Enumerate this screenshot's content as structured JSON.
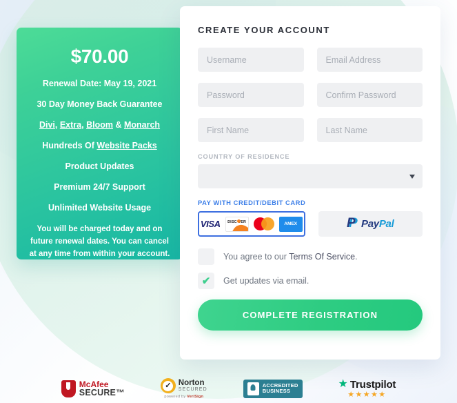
{
  "price_panel": {
    "amount": "$70.00",
    "renewal": "Renewal Date: May 19, 2021",
    "guarantee": "30 Day Money Back Guarantee",
    "products": {
      "divi": "Divi",
      "sep1": ", ",
      "extra": "Extra",
      "sep2": ", ",
      "bloom": "Bloom",
      "sep3": " & ",
      "monarch": "Monarch"
    },
    "packs_prefix": "Hundreds Of ",
    "packs_link": "Website Packs",
    "updates": "Product Updates",
    "support": "Premium 24/7 Support",
    "usage": "Unlimited Website Usage",
    "note": "You will be charged today and on future renewal dates. You can cancel at any time from within your account."
  },
  "form": {
    "title": "CREATE YOUR ACCOUNT",
    "fields": {
      "username": {
        "placeholder": "Username",
        "value": ""
      },
      "email": {
        "placeholder": "Email Address",
        "value": ""
      },
      "password": {
        "placeholder": "Password",
        "value": ""
      },
      "confirm_password": {
        "placeholder": "Confirm Password",
        "value": ""
      },
      "first_name": {
        "placeholder": "First Name",
        "value": ""
      },
      "last_name": {
        "placeholder": "Last Name",
        "value": ""
      }
    },
    "country": {
      "label": "COUNTRY OF RESIDENCE",
      "selected": "",
      "caret_icon": "chevron-down-icon"
    },
    "payment": {
      "label": "PAY WITH CREDIT/DEBIT CARD",
      "card_option": {
        "selected": true,
        "logos": [
          "VISA",
          "DISCOVER",
          "mastercard",
          "AMEX"
        ]
      },
      "paypal_option": {
        "selected": false,
        "label_pay": "Pay",
        "label_pal": "Pal"
      }
    },
    "terms": {
      "checked": false,
      "text_prefix": "You agree to our ",
      "link": "Terms Of Service",
      "text_suffix": "."
    },
    "updates_opt_in": {
      "checked": true,
      "check_icon": "checkmark-icon",
      "text": "Get updates via email."
    },
    "submit_label": "COMPLETE REGISTRATION"
  },
  "badges": {
    "mcafee": {
      "line1": "McAfee",
      "line2": "SECURE™",
      "icon": "shield-icon"
    },
    "norton": {
      "line1": "Norton",
      "line2": "SECURED",
      "check_icon": "checkmark-icon",
      "powered_prefix": "powered by ",
      "powered_brand": "VeriSign"
    },
    "bbb": {
      "line1": "ACCREDITED",
      "line2": "BUSINESS",
      "icon": "bbb-torch-icon"
    },
    "trustpilot": {
      "name": "Trustpilot",
      "star_icon": "star-icon",
      "rating_stars": "★★★★★"
    }
  },
  "colors": {
    "green_accent": "#2ecc82",
    "panel_gradient_start": "#4ddc97",
    "panel_gradient_end": "#17b7a4",
    "blue_link": "#3d7fe8",
    "input_bg": "#eff0f2",
    "page_bg": "#f2f6fc"
  }
}
